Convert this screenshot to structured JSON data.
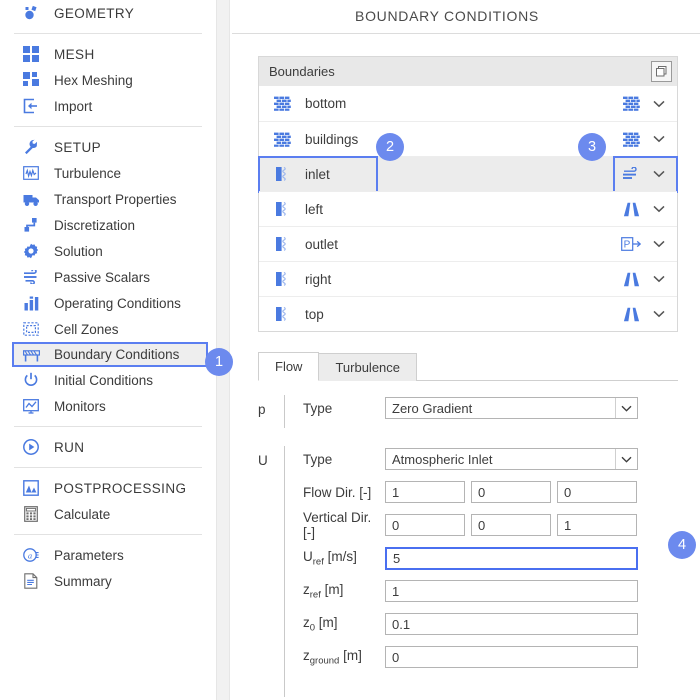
{
  "page": {
    "title": "BOUNDARY CONDITIONS"
  },
  "sidebar": {
    "items": [
      {
        "label": "GEOMETRY",
        "icon": "geometry-icon",
        "kind": "head",
        "selected": false
      },
      {
        "label": "",
        "icon": "",
        "kind": "sep",
        "selected": false
      },
      {
        "label": "MESH",
        "icon": "mesh-icon",
        "kind": "head",
        "selected": false
      },
      {
        "label": "Hex Meshing",
        "icon": "hex-mesh-icon",
        "kind": "item",
        "selected": false
      },
      {
        "label": "Import",
        "icon": "import-icon",
        "kind": "item",
        "selected": false
      },
      {
        "label": "",
        "icon": "",
        "kind": "sep",
        "selected": false
      },
      {
        "label": "SETUP",
        "icon": "wrench-icon",
        "kind": "head",
        "selected": false
      },
      {
        "label": "Turbulence",
        "icon": "turbulence-icon",
        "kind": "item",
        "selected": false
      },
      {
        "label": "Transport Properties",
        "icon": "truck-icon",
        "kind": "item",
        "selected": false
      },
      {
        "label": "Discretization",
        "icon": "discret-icon",
        "kind": "item",
        "selected": false
      },
      {
        "label": "Solution",
        "icon": "gear-icon",
        "kind": "item",
        "selected": false
      },
      {
        "label": "Passive Scalars",
        "icon": "wind-icon",
        "kind": "item",
        "selected": false
      },
      {
        "label": "Operating Conditions",
        "icon": "bars-icon",
        "kind": "item",
        "selected": false
      },
      {
        "label": "Cell Zones",
        "icon": "cellzone-icon",
        "kind": "item",
        "selected": false
      },
      {
        "label": "Boundary Conditions",
        "icon": "boundary-icon",
        "kind": "item",
        "selected": true
      },
      {
        "label": "Initial Conditions",
        "icon": "power-icon",
        "kind": "item",
        "selected": false
      },
      {
        "label": "Monitors",
        "icon": "monitor-icon",
        "kind": "item",
        "selected": false
      },
      {
        "label": "",
        "icon": "",
        "kind": "sep",
        "selected": false
      },
      {
        "label": "RUN",
        "icon": "play-icon",
        "kind": "head",
        "selected": false
      },
      {
        "label": "",
        "icon": "",
        "kind": "sep",
        "selected": false
      },
      {
        "label": "POSTPROCESSING",
        "icon": "postproc-icon",
        "kind": "head",
        "selected": false
      },
      {
        "label": "Calculate",
        "icon": "calculator-icon",
        "kind": "item",
        "selected": false
      },
      {
        "label": "",
        "icon": "",
        "kind": "sep",
        "selected": false
      },
      {
        "label": "Parameters",
        "icon": "parameters-icon",
        "kind": "item",
        "selected": false
      },
      {
        "label": "Summary",
        "icon": "summary-icon",
        "kind": "item",
        "selected": false
      }
    ]
  },
  "boundaries": {
    "header_label": "Boundaries",
    "copy_icon": "copy-icon",
    "rows": [
      {
        "name": "bottom",
        "left_icon": "wall-icon",
        "type_icon": "wall-icon",
        "chevron": "chevron-down-icon",
        "active": false
      },
      {
        "name": "buildings",
        "left_icon": "wall-icon",
        "type_icon": "wall-icon",
        "chevron": "chevron-down-icon",
        "active": false
      },
      {
        "name": "inlet",
        "left_icon": "patch-icon",
        "type_icon": "inlet-icon",
        "chevron": "chevron-down-icon",
        "active": true
      },
      {
        "name": "left",
        "left_icon": "patch-icon",
        "type_icon": "symmetry-icon",
        "chevron": "chevron-down-icon",
        "active": false
      },
      {
        "name": "outlet",
        "left_icon": "patch-icon",
        "type_icon": "pressure-icon",
        "chevron": "chevron-down-icon",
        "active": false
      },
      {
        "name": "right",
        "left_icon": "patch-icon",
        "type_icon": "symmetry-icon",
        "chevron": "chevron-down-icon",
        "active": false
      },
      {
        "name": "top",
        "left_icon": "patch-icon",
        "type_icon": "symmetry-icon",
        "chevron": "chevron-down-icon",
        "active": false
      }
    ]
  },
  "tabs": [
    {
      "label": "Flow",
      "active": true
    },
    {
      "label": "Turbulence",
      "active": false
    }
  ],
  "form": {
    "p": {
      "group_label": "p",
      "type_label": "Type",
      "type_value": "Zero Gradient"
    },
    "u": {
      "group_label": "U",
      "type_label": "Type",
      "type_value": "Atmospheric Inlet",
      "flow_dir_label": "Flow Dir. [-]",
      "flow_dir": [
        "1",
        "0",
        "0"
      ],
      "vertical_dir_label": "Vertical Dir. [-]",
      "vertical_dir": [
        "0",
        "0",
        "1"
      ],
      "uref_label_base": "U",
      "uref_label_sub": "ref",
      "uref_label_unit": " [m/s]",
      "uref_value": "5",
      "zref_label_base": "z",
      "zref_label_sub": "ref",
      "zref_label_unit": " [m]",
      "zref_value": "1",
      "z0_label_base": "z",
      "z0_label_sub": "0",
      "z0_label_unit": " [m]",
      "z0_value": "0.1",
      "zground_label_base": "z",
      "zground_label_sub": "ground",
      "zground_label_unit": " [m]",
      "zground_value": "0"
    }
  },
  "badges": [
    {
      "number": "1"
    },
    {
      "number": "2"
    },
    {
      "number": "3"
    },
    {
      "number": "4"
    }
  ],
  "colors": {
    "accent": "#4a6ff0",
    "badge": "#6c8aee",
    "icon_blue": "#4a7ae0",
    "text": "#3c3c3c"
  }
}
